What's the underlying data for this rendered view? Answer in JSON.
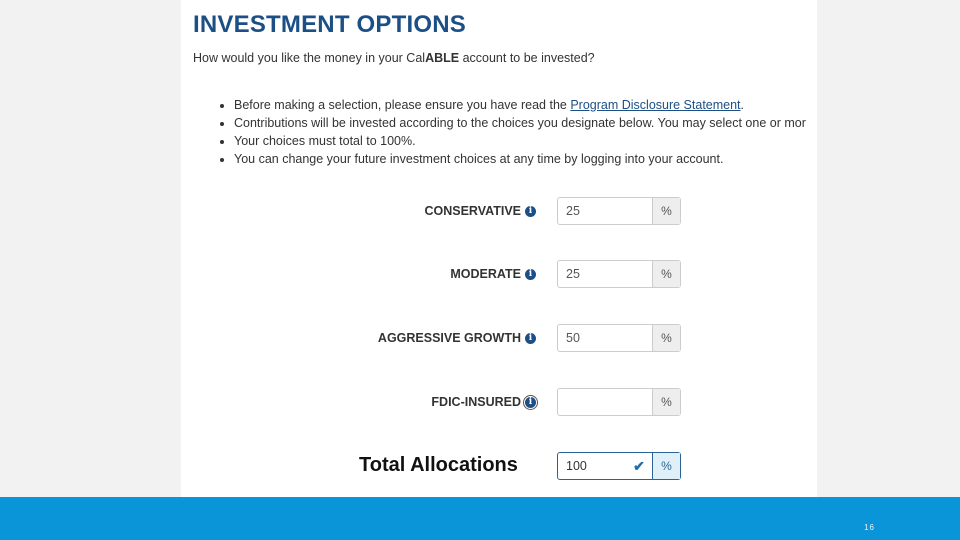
{
  "title": "INVESTMENT OPTIONS",
  "question": {
    "pre": "How would you like the money in your Cal",
    "bold": "ABLE",
    "post": " account to be invested?"
  },
  "bullets": {
    "b1_pre": "Before making a selection, please ensure you have read the ",
    "b1_link": "Program Disclosure Statement",
    "b1_post": ".",
    "b2": "Contributions will be invested according to the choices you designate below. You may select one or mor",
    "b3": "Your choices must total to 100%.",
    "b4": "You can change your future investment choices at any time by logging into your account."
  },
  "options": [
    {
      "label": "CONSERVATIVE",
      "value": "25",
      "unit": "%"
    },
    {
      "label": "MODERATE",
      "value": "25",
      "unit": "%"
    },
    {
      "label": "AGGRESSIVE GROWTH",
      "value": "50",
      "unit": "%"
    },
    {
      "label": "FDIC-INSURED",
      "value": "",
      "unit": "%"
    }
  ],
  "total": {
    "label": "Total Allocations",
    "value": "100",
    "unit": "%"
  },
  "info_icon_glyph": "i",
  "check_glyph": "✔",
  "page_number": "16"
}
